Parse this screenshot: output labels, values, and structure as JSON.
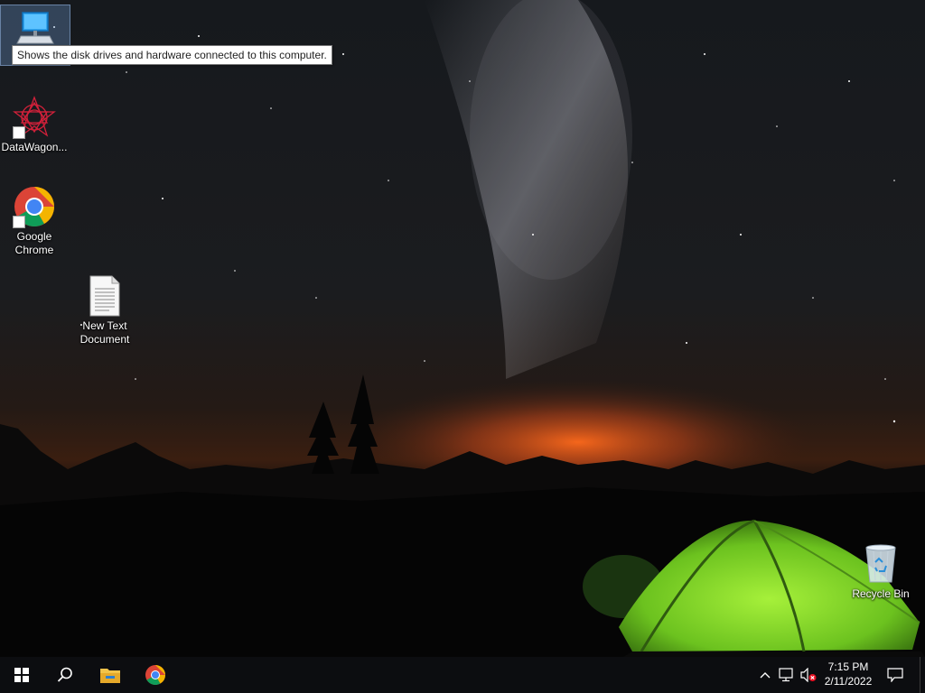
{
  "desktop": {
    "icons": [
      {
        "name": "This PC",
        "icon": "computer-icon",
        "selected": true
      },
      {
        "label": "DataWagon...",
        "icon": "datawagon-icon",
        "shortcut": true
      },
      {
        "label": "Google\nChrome",
        "icon": "chrome-icon",
        "shortcut": true
      },
      {
        "label": "New Text\nDocument",
        "icon": "text-document-icon"
      },
      {
        "label": "Recycle Bin",
        "icon": "recycle-bin-icon"
      }
    ],
    "tooltip": "Shows the disk drives and hardware connected to this computer."
  },
  "taskbar": {
    "start": "windows-start-icon",
    "search": "search-icon",
    "pinned": [
      "file-explorer-icon",
      "chrome-icon"
    ],
    "tray": {
      "chevron": "chevron-up-icon",
      "network": "network-icon",
      "volume": "volume-muted-icon",
      "notifications": "action-center-icon"
    },
    "clock": {
      "time": "7:15 PM",
      "date": "2/11/2022"
    }
  },
  "colors": {
    "taskbar": "#0c0d10",
    "tent": "#7bd82a",
    "horizon": "#d9561a"
  }
}
